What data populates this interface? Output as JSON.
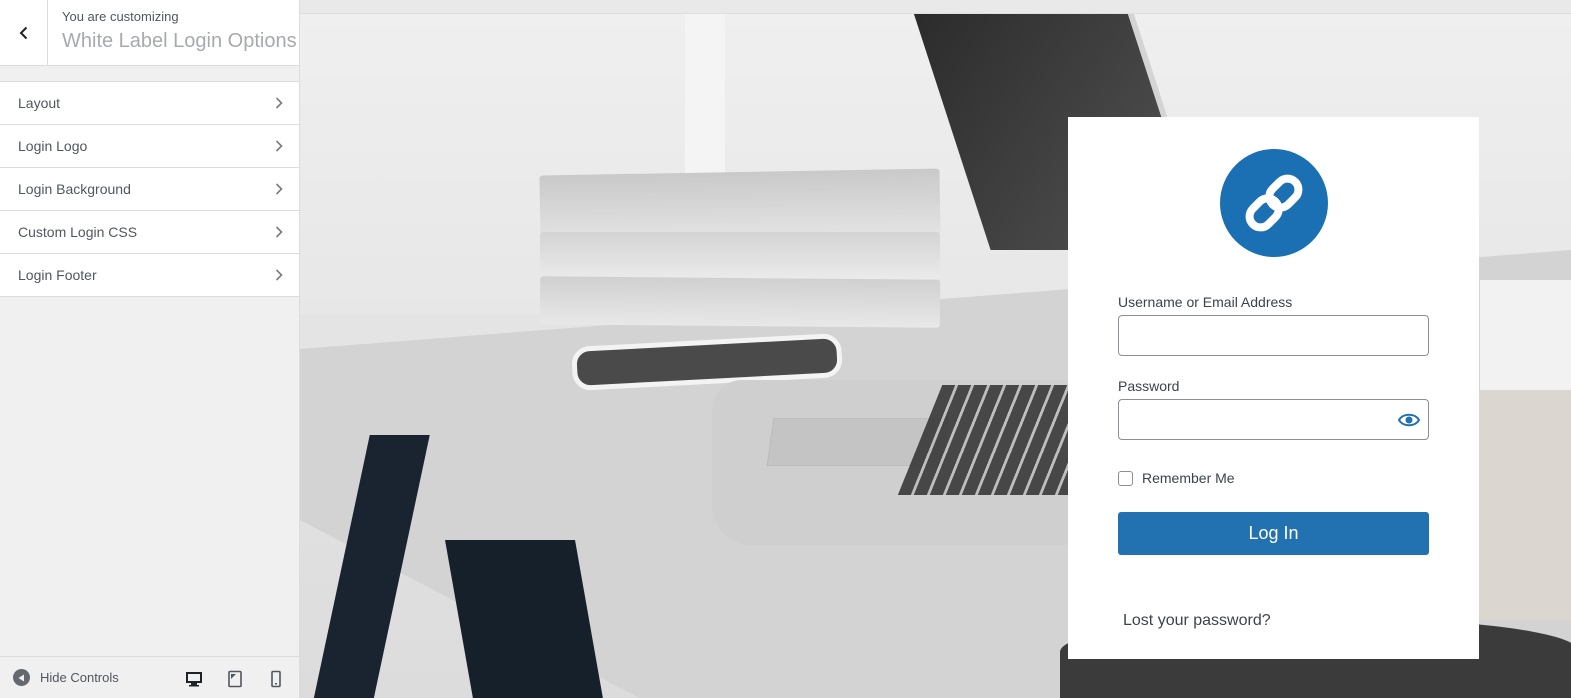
{
  "sidebar": {
    "header": {
      "customizing_label": "You are customizing",
      "title": "White Label Login Options"
    },
    "items": [
      {
        "label": "Layout"
      },
      {
        "label": "Login Logo"
      },
      {
        "label": "Login Background"
      },
      {
        "label": "Custom Login CSS"
      },
      {
        "label": "Login Footer"
      }
    ],
    "footer": {
      "hide_controls_label": "Hide Controls",
      "devices": [
        "desktop-icon",
        "tablet-icon",
        "mobile-icon"
      ]
    }
  },
  "login": {
    "logo_icon": "link-icon",
    "username_label": "Username or Email Address",
    "username_value": "",
    "password_label": "Password",
    "password_value": "",
    "remember_label": "Remember Me",
    "login_button": "Log In",
    "lost_password": "Lost your password?"
  },
  "colors": {
    "accent": "#2271b1",
    "logo_bg": "#1b6fb3"
  }
}
